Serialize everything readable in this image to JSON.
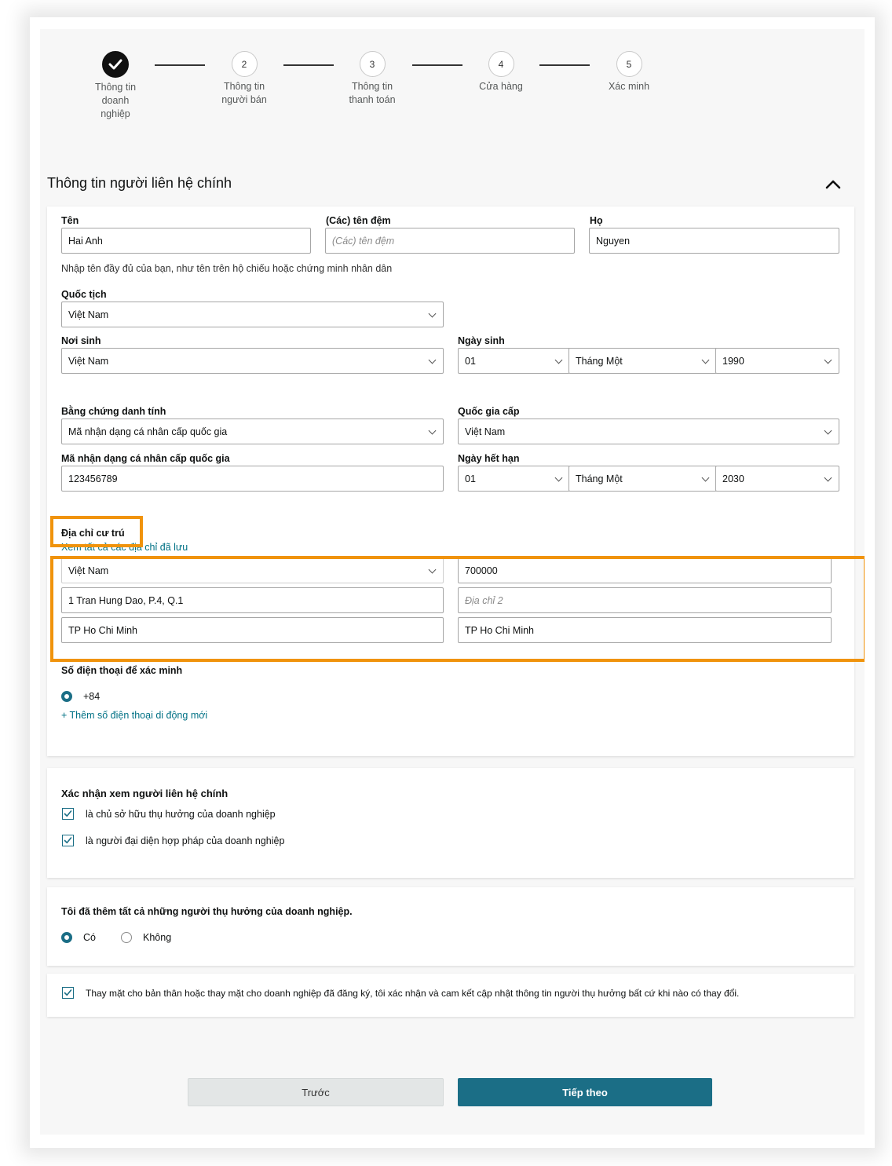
{
  "stepper": {
    "steps": [
      {
        "number": "",
        "label_lines": [
          "Thông tin",
          "doanh",
          "nghiệp"
        ],
        "status": "done"
      },
      {
        "number": "2",
        "label_lines": [
          "Thông tin",
          "người bán"
        ],
        "status": "pending"
      },
      {
        "number": "3",
        "label_lines": [
          "Thông tin",
          "thanh toán"
        ],
        "status": "pending"
      },
      {
        "number": "4",
        "label_lines": [
          "Cửa hàng"
        ],
        "status": "pending"
      },
      {
        "number": "5",
        "label_lines": [
          "Xác minh"
        ],
        "status": "pending"
      }
    ]
  },
  "section": {
    "title": "Thông tin người liên hệ chính"
  },
  "name": {
    "first_label": "Tên",
    "first_value": "Hai Anh",
    "middle_label": "(Các) tên đệm",
    "middle_placeholder": "(Các) tên đệm",
    "last_label": "Họ",
    "last_value": "Nguyen",
    "hint": "Nhập tên đầy đủ của bạn, như tên trên hộ chiếu hoặc chứng minh nhân dân"
  },
  "nationality": {
    "label": "Quốc tịch",
    "value": "Việt Nam"
  },
  "birthplace": {
    "label": "Nơi sinh",
    "value": "Việt Nam"
  },
  "birthdate": {
    "label": "Ngày sinh",
    "day": "01",
    "month": "Tháng Một",
    "year": "1990"
  },
  "id_proof": {
    "label": "Bằng chứng danh tính",
    "value": "Mã nhận dạng cá nhân cấp quốc gia"
  },
  "issuing_country": {
    "label": "Quốc gia cấp",
    "value": "Việt Nam"
  },
  "id_number": {
    "label": "Mã nhận dạng cá nhân cấp quốc gia",
    "value": "123456789"
  },
  "expiry": {
    "label": "Ngày hết hạn",
    "day": "01",
    "month": "Tháng Một",
    "year": "2030"
  },
  "address": {
    "label": "Địa chỉ cư trú",
    "saved_link": "Xem tất cả các địa chỉ đã lưu",
    "country": "Việt Nam",
    "postal_code": "700000",
    "line1": "1 Tran Hung Dao, P.4, Q.1",
    "line2_placeholder": "Địa chỉ 2",
    "city": "TP Ho Chi Minh",
    "province": "TP Ho Chi Minh"
  },
  "phone": {
    "label": "Số điện thoại để xác minh",
    "value": "+84",
    "add_link": "+ Thêm số điện thoại di động mới"
  },
  "confirm_contact": {
    "title": "Xác nhận xem người liên hệ chính",
    "options": [
      "là chủ sở hữu thụ hưởng của doanh nghiệp",
      "là người đại diện hợp pháp của doanh nghiệp"
    ]
  },
  "beneficiaries": {
    "question": "Tôi đã thêm tất cả những người thụ hưởng của doanh nghiệp.",
    "yes": "Có",
    "no": "Không",
    "selected": "yes"
  },
  "declaration": {
    "text": "Thay mặt cho bản thân hoặc thay mặt cho doanh nghiệp đã đăng ký, tôi xác nhận và cam kết cập nhật thông tin người thụ hưởng bất cứ khi nào có thay đổi."
  },
  "buttons": {
    "back": "Trước",
    "next": "Tiếp theo"
  },
  "colors": {
    "accent": "#1b6e86",
    "highlight": "#f0930c",
    "link": "#007185"
  }
}
